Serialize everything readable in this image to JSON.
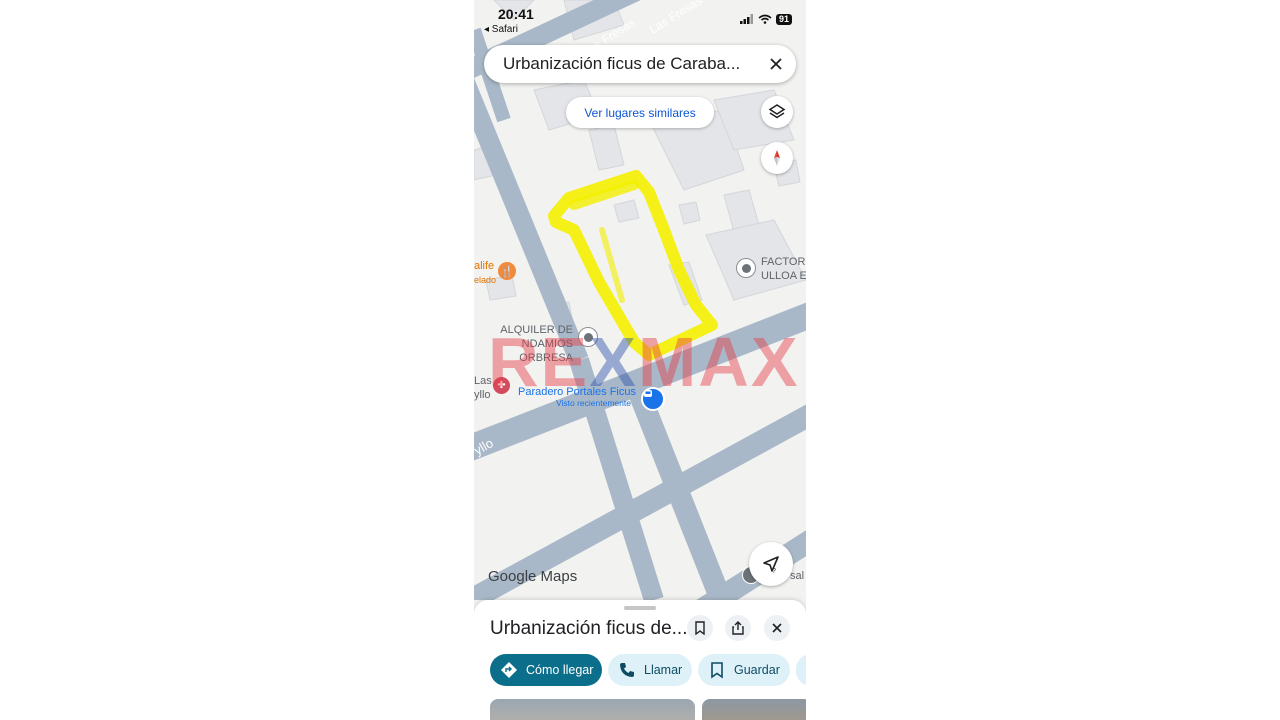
{
  "status_bar": {
    "time": "20:41",
    "back_app": "◂ Safari",
    "battery": "91"
  },
  "search": {
    "value": "Urbanización ficus de Caraba...",
    "close_icon": "close-icon"
  },
  "similar_places_label": "Ver lugares similares",
  "map": {
    "street_labels": [
      "Las Fresas",
      "Las Fresas",
      "yllo"
    ],
    "places": [
      {
        "line1": "FACTORI",
        "line2": "ULLOA E"
      },
      {
        "line1": "ALQUILER DE",
        "line2": "NDAMIOS ORBRESA"
      },
      {
        "line1": "Paradero Portales Ficus",
        "line2": "Visto recientemente"
      },
      {
        "line1": "alife",
        "line2": "elado"
      },
      {
        "line1": "Las",
        "line2": "yllo"
      }
    ],
    "edge_label": "sal",
    "highlight_color": "#f4f000",
    "road_color": "#a9b8c8"
  },
  "watermark": {
    "part1": "RE",
    "part2": "X",
    "part3": "MAX"
  },
  "google_maps_logo": {
    "google": "Google",
    "maps": "Maps"
  },
  "sheet": {
    "title": "Urbanización ficus de...",
    "chips": [
      {
        "label": "Cómo llegar",
        "icon": "directions-icon"
      },
      {
        "label": "Llamar",
        "icon": "phone-icon"
      },
      {
        "label": "Guardar",
        "icon": "bookmark-icon"
      }
    ]
  },
  "colors": {
    "accent": "#0b6f8c",
    "chip_secondary": "#dff1f8",
    "link": "#0b57d0"
  }
}
